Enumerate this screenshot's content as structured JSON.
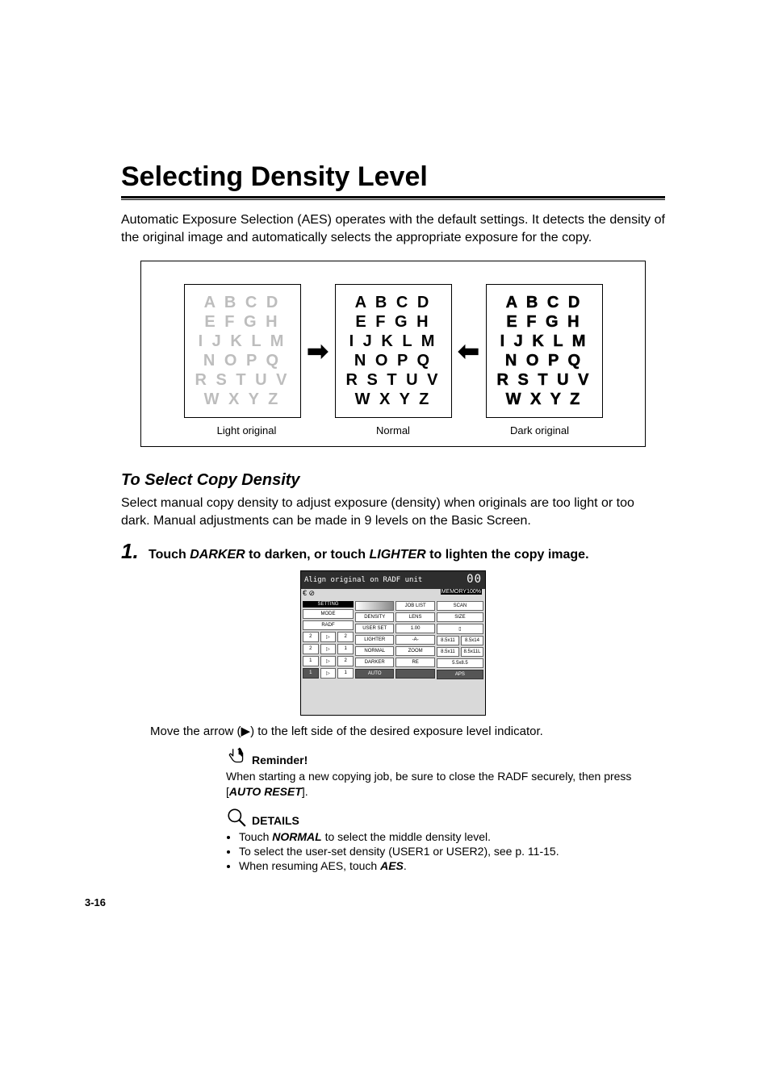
{
  "title": "Selecting Density Level",
  "intro": "Automatic Exposure Selection (AES) operates with the default settings. It detects the density of the original image and automatically selects the appropriate exposure for the copy.",
  "figure": {
    "samples": {
      "lines": [
        "A B C D",
        "E F G H",
        "I J K L M",
        "N O P Q",
        "R S T U V",
        "W X Y Z"
      ]
    },
    "captions": {
      "light": "Light original",
      "normal": "Normal",
      "dark": "Dark original"
    }
  },
  "subheading": "To Select Copy Density",
  "select_body": "Select manual copy density to adjust exposure (density) when originals are too light or too dark. Manual adjustments can be made in 9 levels on the Basic Screen.",
  "step1": {
    "num": "1.",
    "pre": "Touch ",
    "kw1": "DARKER",
    "mid": " to darken, or touch ",
    "kw2": "LIGHTER",
    "post": " to lighten the copy image."
  },
  "screen": {
    "topline": "Align original on RADF unit",
    "seg": "00",
    "memory": "MEMORY100%",
    "iconstrip": "€ ⊘",
    "headers": {
      "setting": "SETTING",
      "joblist": "JOB LIST",
      "scan": "SCAN"
    },
    "cols": {
      "mode": "MODE",
      "density": "DENSITY",
      "lens": "LENS",
      "size": "SIZE"
    },
    "buttons": {
      "radf": "RADF",
      "userset": "USER SET",
      "one": "1.00",
      "lighter": "LIGHTER",
      "a": "-A-",
      "zoom": "ZOOM",
      "re": "RE",
      "normal": "NORMAL",
      "darker": "DARKER",
      "auto": "AUTO",
      "aps": "APS",
      "s1": "8.5x11",
      "s2": "8.5x14",
      "s3": "8.5x11",
      "s4": "8.5x11L",
      "s5": "5.5x8.5"
    }
  },
  "move_text_pre": "Move the arrow (",
  "move_text_sym": "▶",
  "move_text_post": ") to the left side of the desired exposure level indicator.",
  "reminder": {
    "title": "Reminder!",
    "body_pre": "When starting a new copying job, be sure to close the RADF securely, then press [",
    "body_kw": "AUTO RESET",
    "body_post": "]."
  },
  "details": {
    "title": "DETAILS",
    "items": [
      {
        "pre": "Touch ",
        "kw": "NORMAL",
        "post": " to select the middle density level."
      },
      {
        "text": "To select the user-set density (USER1 or USER2), see p. 11-15."
      },
      {
        "pre": "When resuming AES, touch ",
        "kw": "AES",
        "post": "."
      }
    ]
  },
  "page_num": "3-16"
}
